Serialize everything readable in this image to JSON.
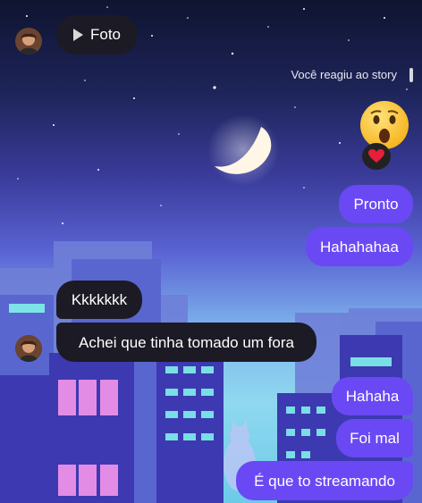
{
  "story": {
    "media_label": "Foto",
    "reaction_caption": "Você reagiu ao story",
    "reaction_emoji": "surprised-face",
    "reaction_badge": "heart"
  },
  "messages": [
    {
      "side": "received",
      "text": "Kkkkkkk"
    },
    {
      "side": "received",
      "text": "Achei que tinha tomado um fora"
    },
    {
      "side": "sent",
      "text": "Pronto"
    },
    {
      "side": "sent",
      "text": "Hahahahaa"
    },
    {
      "side": "sent",
      "text": "Hahaha"
    },
    {
      "side": "sent",
      "text": "Foi mal"
    },
    {
      "side": "sent",
      "text": "É que to streamando"
    }
  ],
  "colors": {
    "sent_bubble": "#6a49f4",
    "received_bubble": "#1c1a24",
    "sky_top": "#111634",
    "sky_bottom": "#7fd0f0"
  }
}
